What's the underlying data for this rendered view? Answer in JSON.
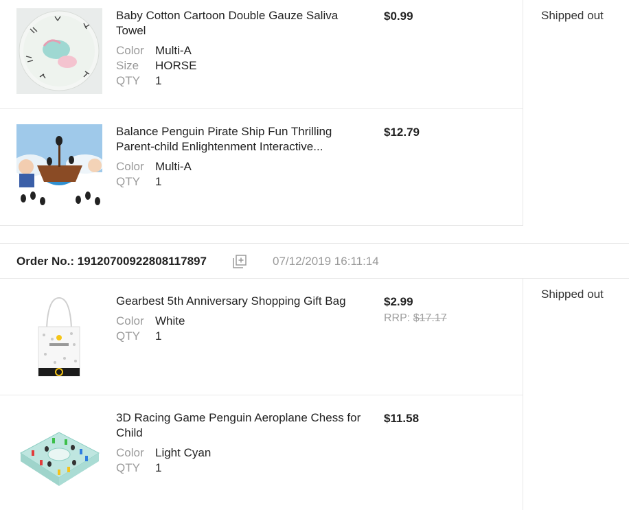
{
  "orders": [
    {
      "status": "Shipped out",
      "items": [
        {
          "title": "Baby Cotton Cartoon Double Gauze Saliva Towel",
          "price": "$0.99",
          "attrs": [
            {
              "label": "Color",
              "value": "Multi-A"
            },
            {
              "label": "Size",
              "value": "HORSE"
            },
            {
              "label": "QTY",
              "value": "1"
            }
          ],
          "image_icon": "saliva-towel-image"
        },
        {
          "title": "Balance Penguin Pirate Ship Fun Thrilling Parent-child Enlightenment Interactive...",
          "price": "$12.79",
          "attrs": [
            {
              "label": "Color",
              "value": "Multi-A"
            },
            {
              "label": "QTY",
              "value": "1"
            }
          ],
          "image_icon": "penguin-pirate-ship-image"
        }
      ]
    },
    {
      "order_no_label": "Order No.:",
      "order_no": "19120700922808117897",
      "date": "07/12/2019 16:11:14",
      "status": "Shipped out",
      "items": [
        {
          "title": "Gearbest 5th Anniversary Shopping Gift Bag",
          "price": "$2.99",
          "rrp_label": "RRP:",
          "rrp_value": "$17.17",
          "attrs": [
            {
              "label": "Color",
              "value": "White"
            },
            {
              "label": "QTY",
              "value": "1"
            }
          ],
          "image_icon": "gift-bag-image"
        },
        {
          "title": "3D Racing Game Penguin Aeroplane Chess for Child",
          "price": "$11.58",
          "attrs": [
            {
              "label": "Color",
              "value": "Light Cyan"
            },
            {
              "label": "QTY",
              "value": "1"
            }
          ],
          "image_icon": "penguin-chess-image"
        }
      ]
    }
  ]
}
